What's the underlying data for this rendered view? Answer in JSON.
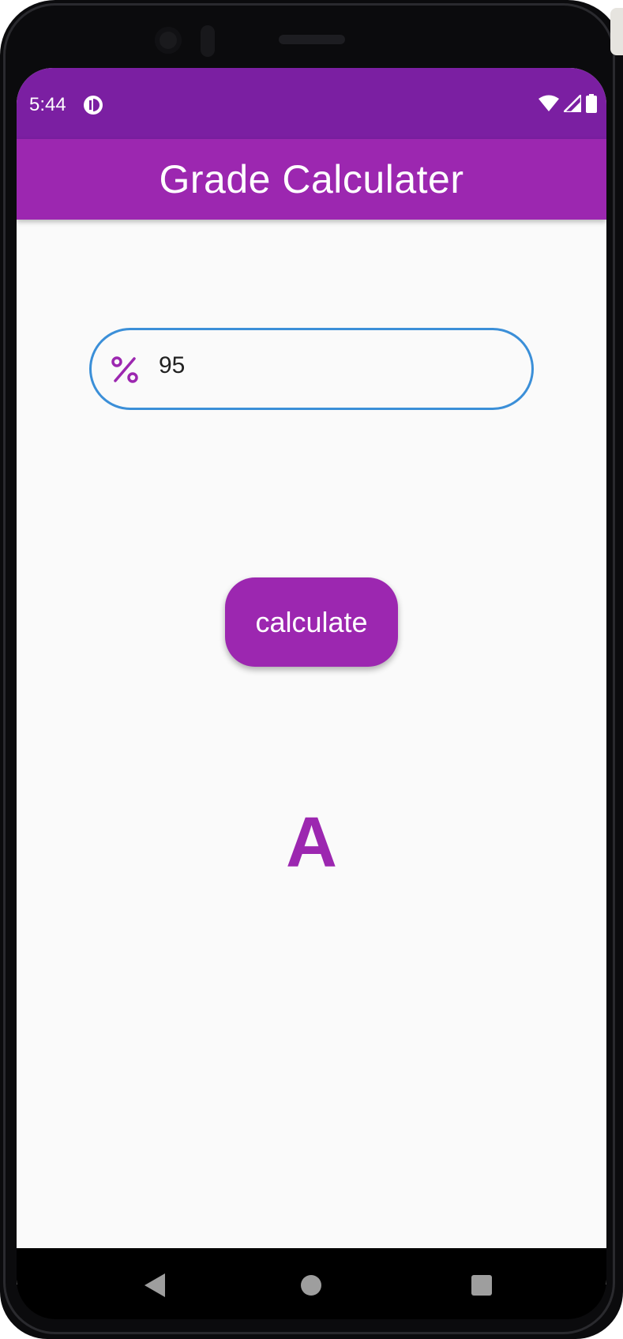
{
  "status_bar": {
    "time": "5:44",
    "color": "#7b1fa2"
  },
  "app_bar": {
    "title": "Grade Calculater",
    "color": "#9c27b0"
  },
  "percent_field": {
    "value": "95",
    "icon": "percent-icon",
    "border_color": "#3b8fd8"
  },
  "calculate_button": {
    "label": "calculate"
  },
  "result": {
    "grade": "A"
  },
  "nav_bar": {
    "icons": [
      "back-icon",
      "home-icon",
      "recents-icon"
    ]
  }
}
